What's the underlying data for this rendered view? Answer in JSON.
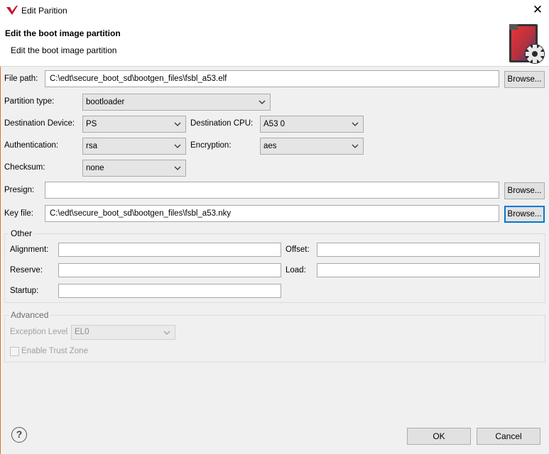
{
  "window": {
    "title": "Edit Parition",
    "close_glyph": "✕"
  },
  "header": {
    "title": "Edit the boot image partition",
    "subtitle": "Edit the boot image partition",
    "icon": "boot-image-settings-icon"
  },
  "form": {
    "file_path": {
      "label": "File path:",
      "value": "C:\\edt\\secure_boot_sd\\bootgen_files\\fsbl_a53.elf",
      "browse": "Browse..."
    },
    "partition_type": {
      "label": "Partition type:",
      "value": "bootloader"
    },
    "destination_device": {
      "label": "Destination Device:",
      "value": "PS"
    },
    "destination_cpu": {
      "label": "Destination CPU:",
      "value": "A53 0"
    },
    "authentication": {
      "label": "Authentication:",
      "value": "rsa"
    },
    "encryption": {
      "label": "Encryption:",
      "value": "aes"
    },
    "checksum": {
      "label": "Checksum:",
      "value": "none"
    },
    "presign": {
      "label": "Presign:",
      "value": "",
      "browse": "Browse..."
    },
    "key_file": {
      "label": "Key file:",
      "value": "C:\\edt\\secure_boot_sd\\bootgen_files\\fsbl_a53.nky",
      "browse": "Browse..."
    }
  },
  "other": {
    "title": "Other",
    "alignment": {
      "label": "Alignment:",
      "value": ""
    },
    "offset": {
      "label": "Offset:",
      "value": ""
    },
    "reserve": {
      "label": "Reserve:",
      "value": ""
    },
    "load": {
      "label": "Load:",
      "value": ""
    },
    "startup": {
      "label": "Startup:",
      "value": ""
    }
  },
  "advanced": {
    "title": "Advanced",
    "exception_level": {
      "label": "Exception Level",
      "value": "EL0"
    },
    "trust_zone": {
      "label": "Enable Trust Zone",
      "checked": false
    }
  },
  "footer": {
    "help_glyph": "?",
    "ok": "OK",
    "cancel": "Cancel"
  },
  "colors": {
    "accent": "#0078d7",
    "logo_red": "#c8102e"
  }
}
